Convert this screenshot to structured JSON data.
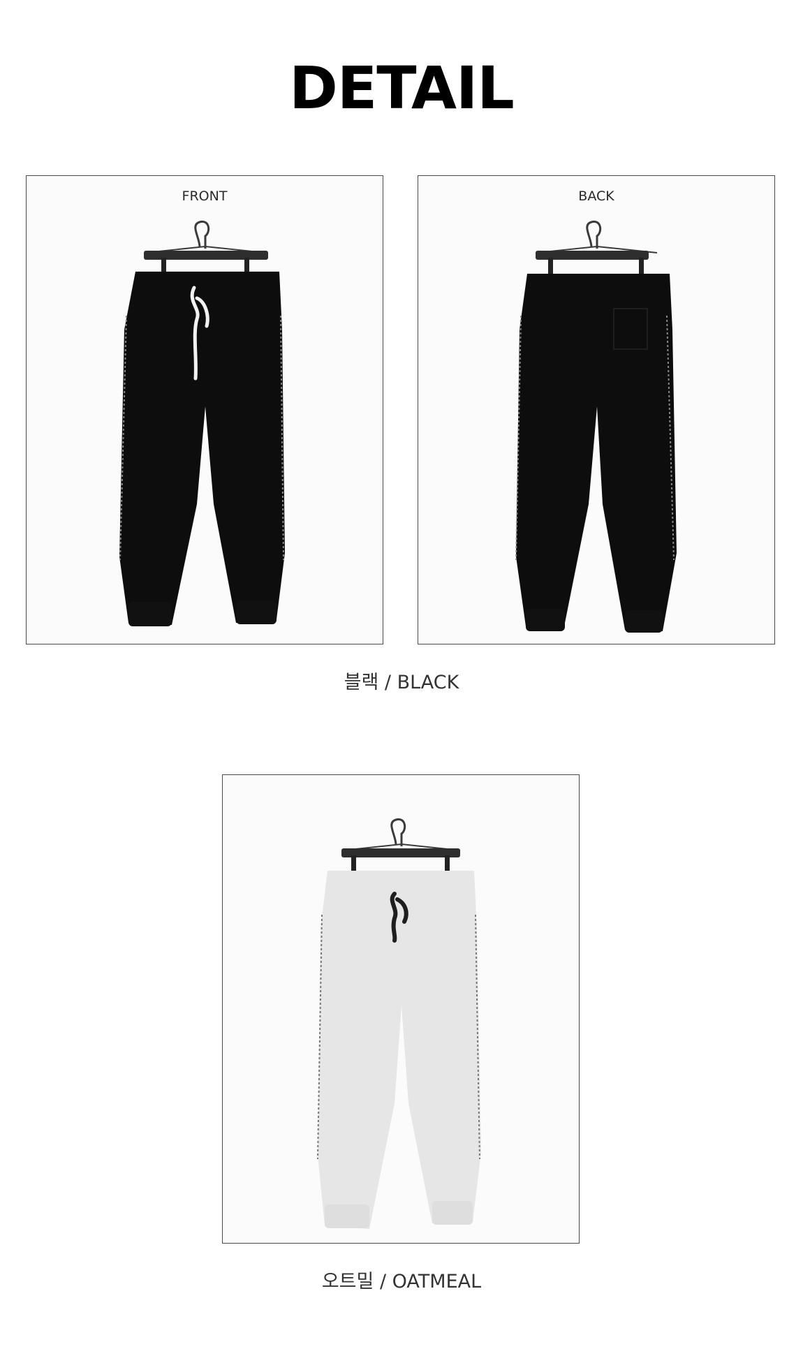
{
  "header": {
    "title": "DETAIL"
  },
  "black_section": {
    "front_label": "FRONT",
    "back_label": "BACK",
    "caption": "블랙 / BLACK"
  },
  "oatmeal_section": {
    "caption": "오트밀 / OATMEAL"
  },
  "colors": {
    "black_pants": "#0d0d0d",
    "oatmeal_pants": "#e6e6e6",
    "frame_border": "#4a4a4a",
    "hanger": "#3a3a3a"
  }
}
